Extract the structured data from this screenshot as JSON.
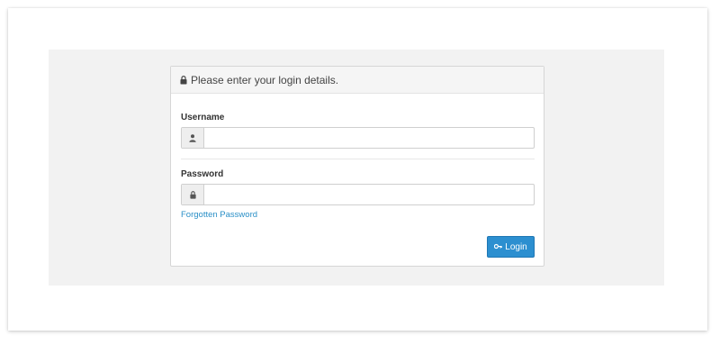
{
  "login_panel": {
    "heading": "Please enter your login details.",
    "heading_icon": "lock-icon",
    "username_label": "Username",
    "username_value": "",
    "username_icon": "user-icon",
    "password_label": "Password",
    "password_value": "",
    "password_icon": "lock-icon",
    "forgot_link": "Forgotten Password",
    "login_button": "Login",
    "login_button_icon": "key-icon"
  },
  "colors": {
    "accent": "#2c8fd0",
    "link": "#2a8fc7",
    "stage_bg": "#f2f2f2"
  }
}
